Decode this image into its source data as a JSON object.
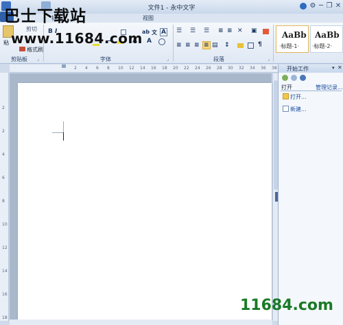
{
  "window": {
    "title": "文件1 - 永中文字",
    "minimize_glyph": "─",
    "restore_glyph": "❐",
    "close_glyph": "✕"
  },
  "tabs": [
    {
      "label": "插入"
    },
    {
      "label": "视图"
    }
  ],
  "ribbon": {
    "clipboard": {
      "label": "剪贴板",
      "cut": "剪切",
      "format_painter": "格式刷",
      "paste": "粘"
    },
    "font": {
      "label": "字体"
    },
    "paragraph": {
      "label": "段落"
    },
    "styles": [
      {
        "sample": "AaBb",
        "name": "·标题-1·"
      },
      {
        "sample": "AaBb",
        "name": "·标题-2·"
      }
    ]
  },
  "watermark": {
    "site": "巴士下载站",
    "url": "www.11684.com",
    "footer": "11684.com"
  },
  "ruler_numbers": [
    "2",
    "4",
    "6",
    "8",
    "10",
    "12",
    "14",
    "16",
    "18",
    "20",
    "22",
    "24",
    "26",
    "28",
    "30",
    "32",
    "34",
    "36",
    "38"
  ],
  "vruler_numbers": [
    "2",
    "2",
    "4",
    "6",
    "8",
    "10",
    "12",
    "14",
    "16",
    "18"
  ],
  "task_pane": {
    "title": "开始工作",
    "open_label": "打开",
    "manage_link": "管理记录...",
    "open_link": "打开...",
    "new_link": "新建..."
  },
  "colors": {
    "accent": "#2f5fa8",
    "link": "#1a4fa3",
    "watermark_green": "#1a7a26"
  }
}
